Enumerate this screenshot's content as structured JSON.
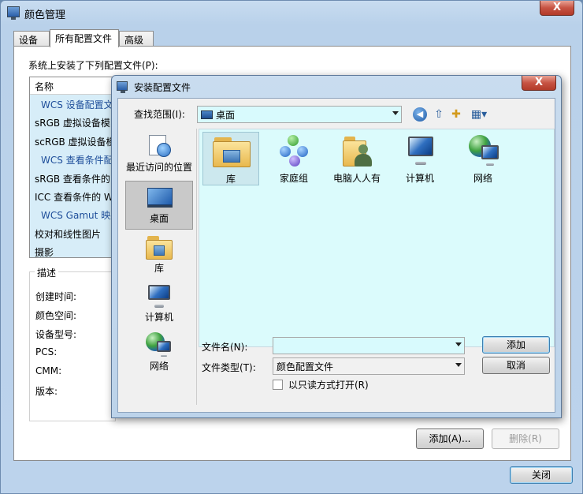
{
  "main_window": {
    "title": "颜色管理",
    "tabs": [
      "设备",
      "所有配置文件",
      "高级"
    ],
    "installed_label": "系统上安装了下列配置文件(P):",
    "list_header": "名称",
    "profiles": [
      {
        "label": "WCS 设备配置文",
        "group": true
      },
      {
        "label": "sRGB 虚拟设备模",
        "group": false
      },
      {
        "label": "scRGB 虚拟设备模",
        "group": false
      },
      {
        "label": "WCS 查看条件配",
        "group": true
      },
      {
        "label": "sRGB 查看条件的",
        "group": false
      },
      {
        "label": "ICC 查看条件的 W",
        "group": false
      },
      {
        "label": "WCS Gamut 映射",
        "group": true
      },
      {
        "label": "校对和线性图片",
        "group": false
      },
      {
        "label": "摄影",
        "group": false
      }
    ],
    "description": {
      "legend": "描述",
      "fields": [
        "创建时间:",
        "颜色空间:",
        "设备型号:",
        "PCS:",
        "CMM:",
        "版本:"
      ]
    },
    "add_button": "添加(A)...",
    "delete_button": "删除(R)",
    "close_button": "关闭",
    "close_glyph": "X"
  },
  "dialog": {
    "title": "安装配置文件",
    "close_glyph": "X",
    "look_in_label": "查找范围(I):",
    "look_in_value": "桌面",
    "toolbar": {
      "back_glyph": "◀",
      "up_glyph": "⇧",
      "new_folder_glyph": "✚",
      "view_glyph": "▦▾"
    },
    "places": [
      "最近访问的位置",
      "桌面",
      "库",
      "计算机",
      "网络"
    ],
    "files": [
      "库",
      "家庭组",
      "电脑人人有",
      "计算机",
      "网络"
    ],
    "filename_label": "文件名(N):",
    "filename_value": "",
    "filetype_label": "文件类型(T):",
    "filetype_value": "颜色配置文件",
    "readonly_label": "以只读方式打开(R)",
    "add_button": "添加",
    "cancel_button": "取消"
  }
}
